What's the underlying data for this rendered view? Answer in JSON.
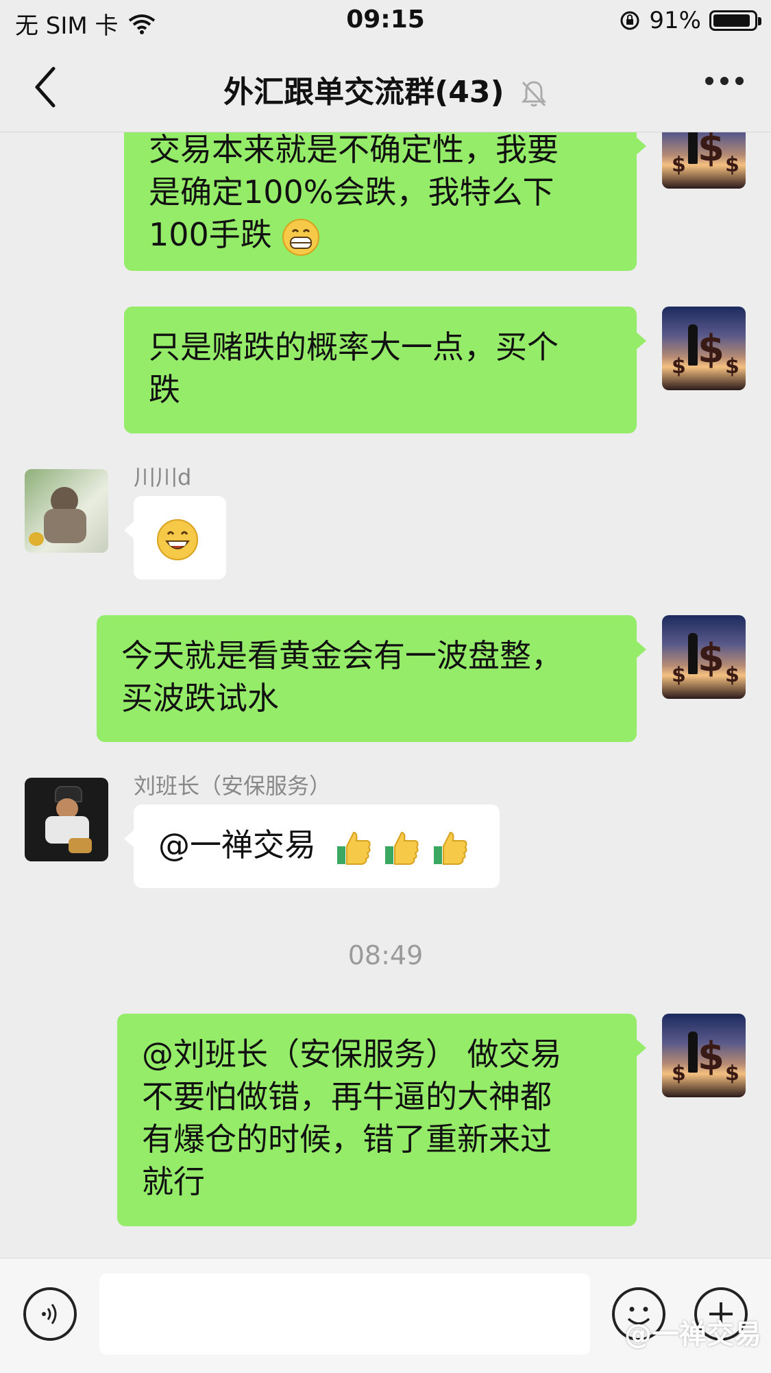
{
  "status_bar": {
    "carrier": "无 SIM 卡",
    "time": "09:15",
    "battery": "91%",
    "battery_level": 0.91
  },
  "header": {
    "title": "外汇跟单交流群(43)"
  },
  "messages": [
    {
      "lines": [
        "交易本来就是不确定性，我要",
        "是确定100%会跌，我特么下",
        "100手跌"
      ],
      "emoji": "grin"
    },
    {
      "lines": [
        "只是赌跌的概率大一点，买个",
        "跌"
      ]
    },
    {
      "sender": "川川d",
      "emoji": "smile"
    },
    {
      "lines": [
        "今天就是看黄金会有一波盘整，",
        "买波跌试水"
      ]
    },
    {
      "sender": "刘班长（安保服务）",
      "text": "@一禅交易",
      "emoji": "thumbs-up x3"
    },
    {
      "lines": [
        "@刘班长（安保服务） 做交易",
        "不要怕做错，再牛逼的大神都",
        "有爆仓的时候，错了重新来过",
        "就行"
      ]
    }
  ],
  "timestamp": "08:49",
  "watermark": "@一禅交易",
  "colors": {
    "self_bubble": "#95ec69",
    "other_bubble": "#ffffff",
    "background": "#ededed"
  }
}
